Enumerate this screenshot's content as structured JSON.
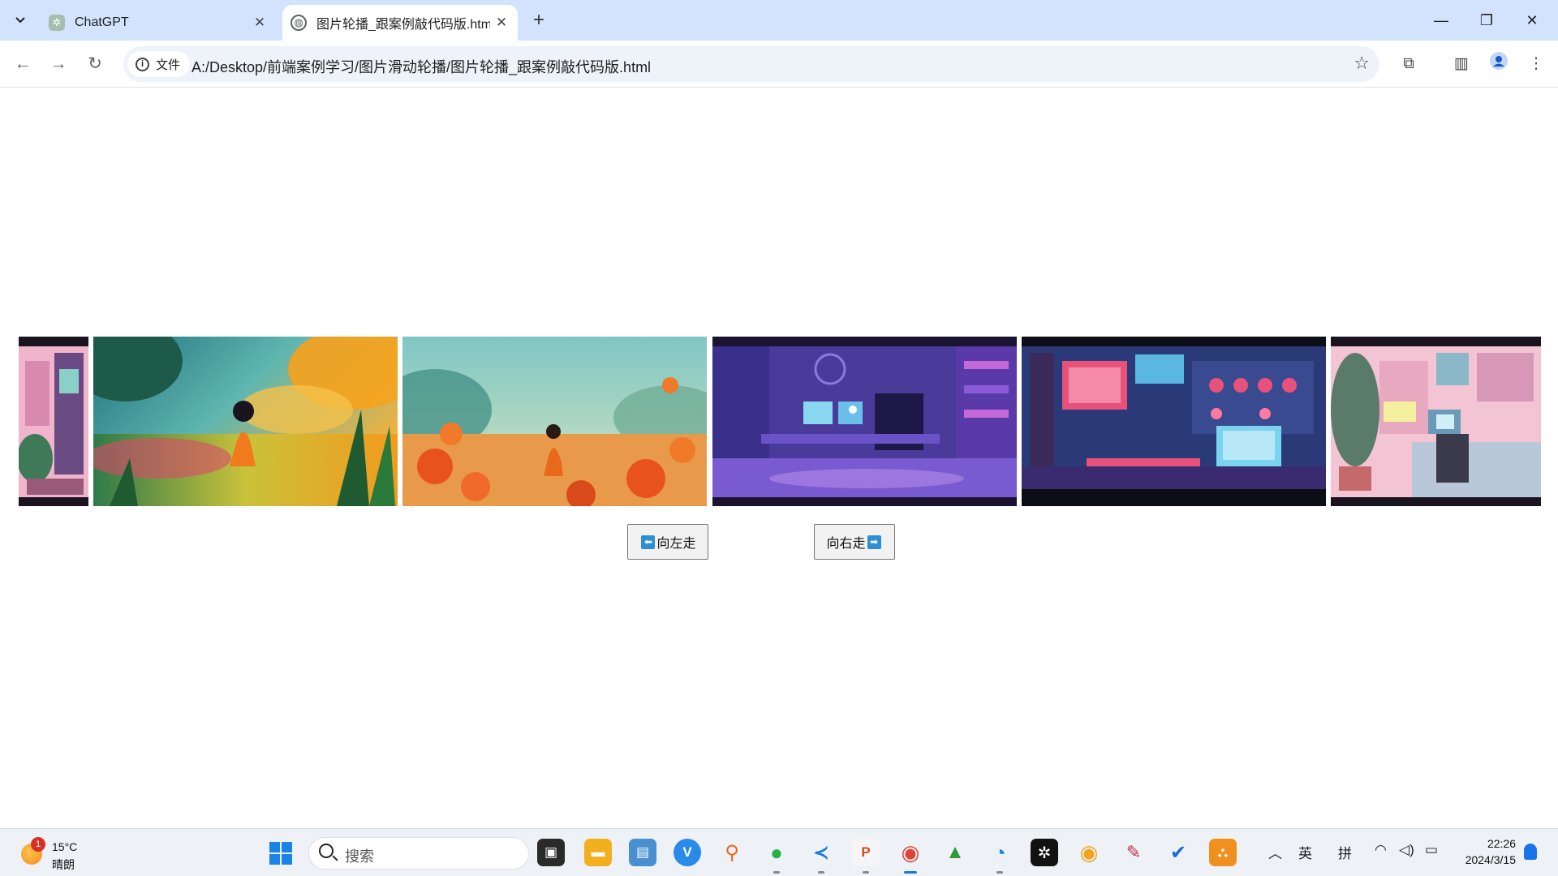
{
  "browser": {
    "tabs": [
      {
        "title": "ChatGPT",
        "active": false
      },
      {
        "title": "图片轮播_跟案例敲代码版.html",
        "active": true
      }
    ],
    "security_chip": "文件",
    "url": "A:/Desktop/前端案例学习/图片滑动轮播/图片轮播_跟案例敲代码版.html"
  },
  "page": {
    "slides": [
      {
        "name": "pink-room",
        "palette": [
          "#f3a3c8",
          "#6b4c8c",
          "#4a8a6a"
        ]
      },
      {
        "name": "girl-in-meadow",
        "palette": [
          "#3fa8a0",
          "#f6a21c",
          "#f57c3a"
        ]
      },
      {
        "name": "child-in-flowers",
        "palette": [
          "#7ec4c0",
          "#f07a2a",
          "#e85a20"
        ]
      },
      {
        "name": "purple-studio",
        "palette": [
          "#6c4fc8",
          "#3a2f8a",
          "#c46ad8"
        ]
      },
      {
        "name": "neon-control-room",
        "palette": [
          "#2a3a78",
          "#e8527a",
          "#5ab8e0"
        ]
      },
      {
        "name": "pastel-room",
        "palette": [
          "#f3b6cc",
          "#8ab8c8",
          "#5a7a6a"
        ]
      }
    ],
    "buttons": {
      "left_label": "向左走",
      "right_label": "向右走"
    }
  },
  "taskbar": {
    "weather": {
      "badge": "1",
      "temperature": "15°C",
      "condition": "晴朗"
    },
    "search_placeholder": "搜索",
    "tray": {
      "ime_lang": "英",
      "ime_mode": "拼"
    },
    "clock": {
      "time": "22:26",
      "date": "2024/3/15"
    }
  }
}
